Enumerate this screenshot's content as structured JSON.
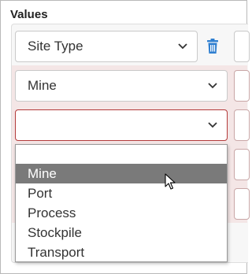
{
  "heading": "Values",
  "rows": [
    {
      "value": "Site Type"
    },
    {
      "value": "Mine"
    },
    {
      "value": ""
    }
  ],
  "dropdown": {
    "options": [
      "",
      "Mine",
      "Port",
      "Process",
      "Stockpile",
      "Transport"
    ],
    "highlighted": "Mine"
  },
  "icons": {
    "delete": "trash-icon",
    "chevron": "chevron-down-icon",
    "cursor": "mouse-pointer-icon"
  },
  "colors": {
    "accent_blue": "#2f7fd0",
    "invalid_border": "#b33a3a",
    "row_tint": "#f4e6e6",
    "highlight": "#7a7a7a"
  }
}
